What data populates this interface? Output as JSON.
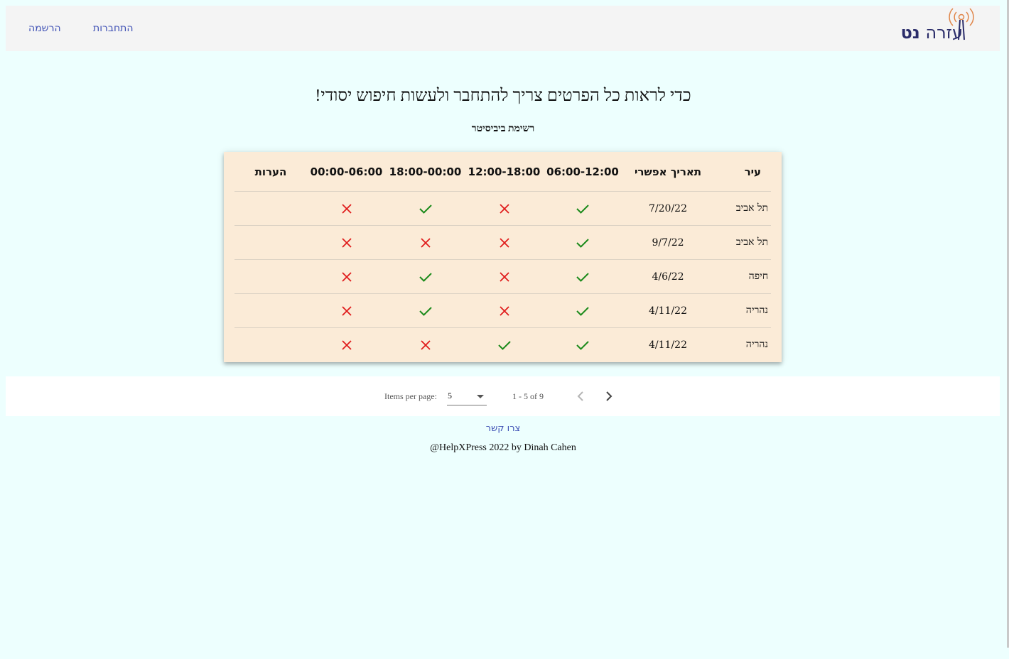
{
  "header": {
    "logo_text_light": "עזרה",
    "logo_text_bold": "נט",
    "nav": {
      "login": "התחברות",
      "register": "הרשמה"
    }
  },
  "main": {
    "title": "כדי לראות כל הפרטים צריך להתחבר ולעשות חיפוש יסודי!",
    "subtitle": "רשימת ביביסיטר"
  },
  "table": {
    "columns": [
      "עיר",
      "תאריך אפשרי",
      "06:00-12:00",
      "12:00-18:00",
      "18:00-00:00",
      "00:00-06:00",
      "הערות"
    ],
    "rows": [
      {
        "city": "תל אביב",
        "date": "7/20/22",
        "slots": [
          true,
          false,
          true,
          false
        ],
        "notes": ""
      },
      {
        "city": "תל אביב",
        "date": "9/7/22",
        "slots": [
          true,
          false,
          false,
          false
        ],
        "notes": ""
      },
      {
        "city": "חיפה",
        "date": "4/6/22",
        "slots": [
          true,
          false,
          true,
          false
        ],
        "notes": ""
      },
      {
        "city": "נהריה",
        "date": "4/11/22",
        "slots": [
          true,
          false,
          true,
          false
        ],
        "notes": ""
      },
      {
        "city": "נהריה",
        "date": "4/11/22",
        "slots": [
          true,
          true,
          false,
          false
        ],
        "notes": ""
      }
    ]
  },
  "paginator": {
    "items_per_page_label": "Items per page:",
    "page_size": "5",
    "range_label": "1 - 5 of 9",
    "prev_icon": "chevron-left-icon",
    "next_icon": "chevron-right-icon"
  },
  "footer": {
    "contact": "צרו קשר",
    "copyright": "@HelpXPress 2022 by Dinah Cahen"
  },
  "colors": {
    "check": "#1a8a1a",
    "cross": "#e01b1b",
    "link": "#3f51b5",
    "card_bg": "#fbebd7",
    "page_bg": "#edfffe"
  }
}
